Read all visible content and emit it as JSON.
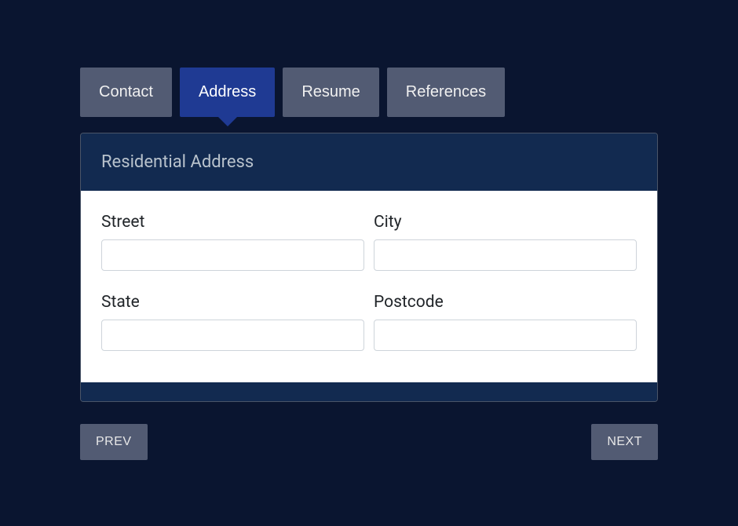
{
  "tabs": {
    "contact": {
      "label": "Contact"
    },
    "address": {
      "label": "Address"
    },
    "resume": {
      "label": "Resume"
    },
    "references": {
      "label": "References"
    }
  },
  "panel": {
    "title": "Residential Address",
    "fields": {
      "street": {
        "label": "Street",
        "value": ""
      },
      "city": {
        "label": "City",
        "value": ""
      },
      "state": {
        "label": "State",
        "value": ""
      },
      "postcode": {
        "label": "Postcode",
        "value": ""
      }
    }
  },
  "nav": {
    "prev": "PREV",
    "next": "NEXT"
  }
}
